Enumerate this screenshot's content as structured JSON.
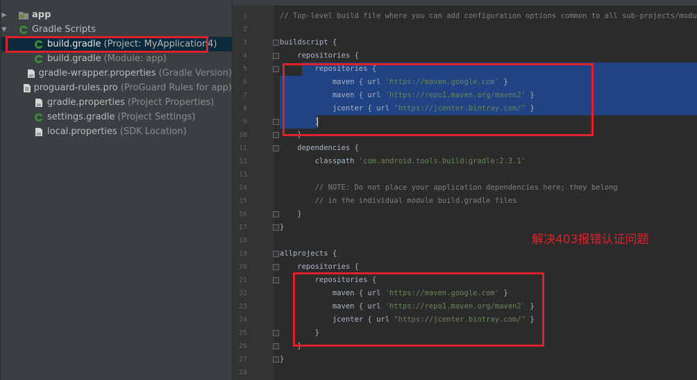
{
  "project_tree": {
    "app": "app",
    "gradle_scripts": "Gradle Scripts",
    "items": [
      {
        "name": "build.gradle",
        "hint": "(Project: MyApplication4)"
      },
      {
        "name": "build.gradle",
        "hint": "(Module: app)"
      },
      {
        "name": "gradle-wrapper.properties",
        "hint": "(Gradle Version)"
      },
      {
        "name": "proguard-rules.pro",
        "hint": "(ProGuard Rules for app)"
      },
      {
        "name": "gradle.properties",
        "hint": "(Project Properties)"
      },
      {
        "name": "settings.gradle",
        "hint": "(Project Settings)"
      },
      {
        "name": "local.properties",
        "hint": "(SDK Location)"
      }
    ]
  },
  "editor": {
    "line_numbers": [
      "1",
      "2",
      "3",
      "4",
      "5",
      "6",
      "7",
      "8",
      "9",
      "10",
      "11",
      "12",
      "13",
      "14",
      "15",
      "16",
      "17",
      "18",
      "19",
      "20",
      "21",
      "22",
      "23",
      "24",
      "25",
      "26",
      "27",
      "28"
    ],
    "lines": [
      {
        "t": "// Top-level build file where you can add configuration options common to all sub-projects/modules.",
        "c": "cmt"
      },
      {
        "t": "",
        "c": ""
      },
      {
        "t": "buildscript {",
        "c": ""
      },
      {
        "t": "    repositories {",
        "c": ""
      },
      {
        "t": "        repositories {",
        "c": ""
      },
      {
        "t": "            maven { url 'https://maven.google.com' }",
        "c": "mix"
      },
      {
        "t": "            maven { url 'https://repo1.maven.org/maven2' }",
        "c": "mix"
      },
      {
        "t": "            jcenter { url \"https://jcenter.bintray.com/\" }",
        "c": "mix"
      },
      {
        "t": "        }",
        "c": ""
      },
      {
        "t": "    }",
        "c": ""
      },
      {
        "t": "    dependencies {",
        "c": ""
      },
      {
        "t": "        classpath 'com.android.tools.build:gradle:2.3.1'",
        "c": "mix"
      },
      {
        "t": "",
        "c": ""
      },
      {
        "t": "        // NOTE: Do not place your application dependencies here; they belong",
        "c": "cmt"
      },
      {
        "t": "        // in the individual module build.gradle files",
        "c": "cmt"
      },
      {
        "t": "    }",
        "c": ""
      },
      {
        "t": "}",
        "c": ""
      },
      {
        "t": "",
        "c": ""
      },
      {
        "t": "allprojects {",
        "c": ""
      },
      {
        "t": "    repositories {",
        "c": ""
      },
      {
        "t": "        repositories {",
        "c": ""
      },
      {
        "t": "            maven { url 'https://maven.google.com' }",
        "c": "mix"
      },
      {
        "t": "            maven { url 'https://repo1.maven.org/maven2' }",
        "c": "mix"
      },
      {
        "t": "            jcenter { url \"https://jcenter.bintray.com/\" }",
        "c": "mix"
      },
      {
        "t": "        }",
        "c": ""
      },
      {
        "t": "    }",
        "c": ""
      },
      {
        "t": "}",
        "c": ""
      },
      {
        "t": "",
        "c": ""
      }
    ]
  },
  "annotation": "解决403报错认证问题",
  "colors": {
    "background": "#2b2b2b",
    "selection": "#214283",
    "annotation_red": "#e0202a",
    "string_green": "#6a8759",
    "comment_grey": "#808080"
  }
}
